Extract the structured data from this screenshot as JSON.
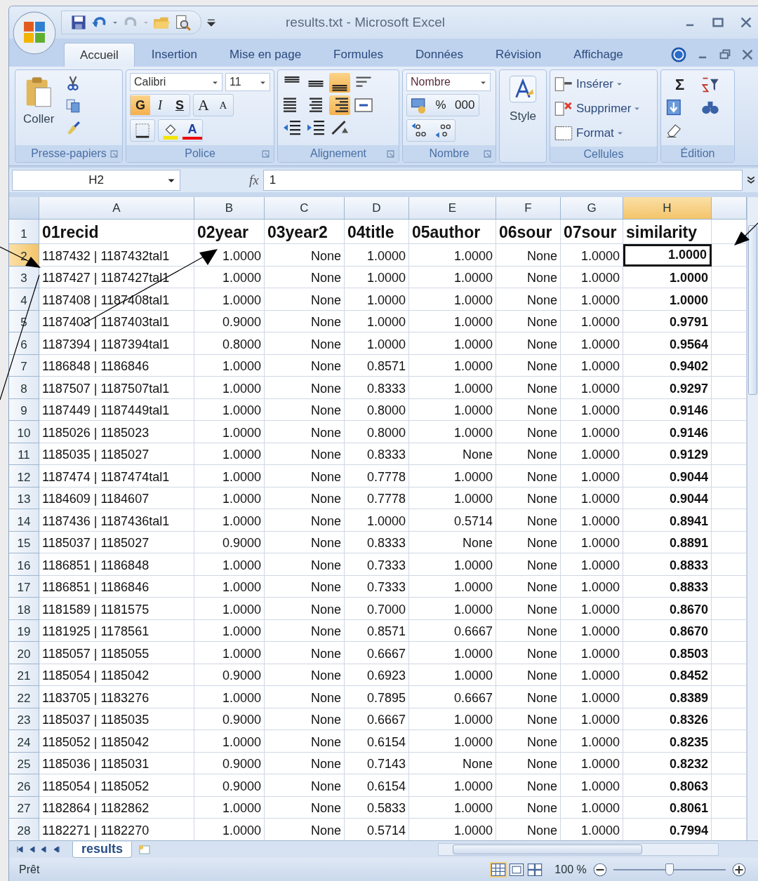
{
  "window": {
    "title": "results.txt - Microsoft Excel"
  },
  "tabs": [
    {
      "label": "Accueil",
      "selected": true
    },
    {
      "label": "Insertion",
      "selected": false
    },
    {
      "label": "Mise en page",
      "selected": false
    },
    {
      "label": "Formules",
      "selected": false
    },
    {
      "label": "Données",
      "selected": false
    },
    {
      "label": "Révision",
      "selected": false
    },
    {
      "label": "Affichage",
      "selected": false
    }
  ],
  "ribbon": {
    "clipboard": {
      "label": "Presse-papiers",
      "paste": "Coller"
    },
    "font": {
      "label": "Police",
      "family": "Calibri",
      "size": "11",
      "styles": [
        {
          "kind": "bold",
          "label": "G",
          "on": true
        },
        {
          "kind": "italic",
          "label": "I",
          "on": false
        },
        {
          "kind": "underline",
          "label": "S",
          "on": false
        }
      ],
      "grow": "A",
      "shrink": "A",
      "color_letter": "A"
    },
    "alignment": {
      "label": "Alignement",
      "vertical": [
        {
          "kind": "top",
          "on": false
        },
        {
          "kind": "middle",
          "on": false
        },
        {
          "kind": "bottom",
          "on": true
        }
      ],
      "horizontal": [
        {
          "kind": "left",
          "on": false
        },
        {
          "kind": "center",
          "on": false
        },
        {
          "kind": "right",
          "on": true
        }
      ]
    },
    "number": {
      "label": "Nombre",
      "format": "Nombre",
      "percent": "%",
      "thousands": "000"
    },
    "style": {
      "label": "Style"
    },
    "cells": {
      "label": "Cellules",
      "items": [
        {
          "kind": "insert",
          "label": "Insérer"
        },
        {
          "kind": "delete",
          "label": "Supprimer"
        },
        {
          "kind": "format",
          "label": "Format"
        }
      ]
    },
    "editing": {
      "label": "Édition",
      "sum": "Σ"
    }
  },
  "formula_bar": {
    "name_box": "H2",
    "fx": "fx",
    "value": "1"
  },
  "sheet": {
    "columns": [
      {
        "label": "A",
        "selected": false,
        "bold": false
      },
      {
        "label": "B",
        "selected": false,
        "bold": false
      },
      {
        "label": "C",
        "selected": false,
        "bold": false
      },
      {
        "label": "D",
        "selected": false,
        "bold": false
      },
      {
        "label": "E",
        "selected": false,
        "bold": false
      },
      {
        "label": "F",
        "selected": false,
        "bold": false
      },
      {
        "label": "G",
        "selected": false,
        "bold": false
      },
      {
        "label": "H",
        "selected": true,
        "bold": true
      }
    ],
    "rows": [
      {
        "label": "1",
        "kind": "header",
        "selected": false,
        "cells": [
          "01recid",
          "02year",
          "03year2",
          "04title",
          "05author",
          "06sour",
          "07sour",
          "similarity"
        ]
      },
      {
        "label": "2",
        "kind": "data",
        "selected": true,
        "cells": [
          "1187432 | 1187432tal1",
          "1.0000",
          "None",
          "1.0000",
          "1.0000",
          "None",
          "1.0000",
          "1.0000"
        ]
      },
      {
        "label": "3",
        "kind": "data",
        "selected": false,
        "cells": [
          "1187427 | 1187427tal1",
          "1.0000",
          "None",
          "1.0000",
          "1.0000",
          "None",
          "1.0000",
          "1.0000"
        ]
      },
      {
        "label": "4",
        "kind": "data",
        "selected": false,
        "cells": [
          "1187408 | 1187408tal1",
          "1.0000",
          "None",
          "1.0000",
          "1.0000",
          "None",
          "1.0000",
          "1.0000"
        ]
      },
      {
        "label": "5",
        "kind": "data",
        "selected": false,
        "cells": [
          "1187403 | 1187403tal1",
          "0.9000",
          "None",
          "1.0000",
          "1.0000",
          "None",
          "1.0000",
          "0.9791"
        ]
      },
      {
        "label": "6",
        "kind": "data",
        "selected": false,
        "cells": [
          "1187394 | 1187394tal1",
          "0.8000",
          "None",
          "1.0000",
          "1.0000",
          "None",
          "1.0000",
          "0.9564"
        ]
      },
      {
        "label": "7",
        "kind": "data",
        "selected": false,
        "cells": [
          "1186848 | 1186846",
          "1.0000",
          "None",
          "0.8571",
          "1.0000",
          "None",
          "1.0000",
          "0.9402"
        ]
      },
      {
        "label": "8",
        "kind": "data",
        "selected": false,
        "cells": [
          "1187507 | 1187507tal1",
          "1.0000",
          "None",
          "0.8333",
          "1.0000",
          "None",
          "1.0000",
          "0.9297"
        ]
      },
      {
        "label": "9",
        "kind": "data",
        "selected": false,
        "cells": [
          "1187449 | 1187449tal1",
          "1.0000",
          "None",
          "0.8000",
          "1.0000",
          "None",
          "1.0000",
          "0.9146"
        ]
      },
      {
        "label": "10",
        "kind": "data",
        "selected": false,
        "cells": [
          "1185026 | 1185023",
          "1.0000",
          "None",
          "0.8000",
          "1.0000",
          "None",
          "1.0000",
          "0.9146"
        ]
      },
      {
        "label": "11",
        "kind": "data",
        "selected": false,
        "cells": [
          "1185035 | 1185027",
          "1.0000",
          "None",
          "0.8333",
          "None",
          "None",
          "1.0000",
          "0.9129"
        ]
      },
      {
        "label": "12",
        "kind": "data",
        "selected": false,
        "cells": [
          "1187474 | 1187474tal1",
          "1.0000",
          "None",
          "0.7778",
          "1.0000",
          "None",
          "1.0000",
          "0.9044"
        ]
      },
      {
        "label": "13",
        "kind": "data",
        "selected": false,
        "cells": [
          "1184609 | 1184607",
          "1.0000",
          "None",
          "0.7778",
          "1.0000",
          "None",
          "1.0000",
          "0.9044"
        ]
      },
      {
        "label": "14",
        "kind": "data",
        "selected": false,
        "cells": [
          "1187436 | 1187436tal1",
          "1.0000",
          "None",
          "1.0000",
          "0.5714",
          "None",
          "1.0000",
          "0.8941"
        ]
      },
      {
        "label": "15",
        "kind": "data",
        "selected": false,
        "cells": [
          "1185037 | 1185027",
          "0.9000",
          "None",
          "0.8333",
          "None",
          "None",
          "1.0000",
          "0.8891"
        ]
      },
      {
        "label": "16",
        "kind": "data",
        "selected": false,
        "cells": [
          "1186851 | 1186848",
          "1.0000",
          "None",
          "0.7333",
          "1.0000",
          "None",
          "1.0000",
          "0.8833"
        ]
      },
      {
        "label": "17",
        "kind": "data",
        "selected": false,
        "cells": [
          "1186851 | 1186846",
          "1.0000",
          "None",
          "0.7333",
          "1.0000",
          "None",
          "1.0000",
          "0.8833"
        ]
      },
      {
        "label": "18",
        "kind": "data",
        "selected": false,
        "cells": [
          "1181589 | 1181575",
          "1.0000",
          "None",
          "0.7000",
          "1.0000",
          "None",
          "1.0000",
          "0.8670"
        ]
      },
      {
        "label": "19",
        "kind": "data",
        "selected": false,
        "cells": [
          "1181925 | 1178561",
          "1.0000",
          "None",
          "0.8571",
          "0.6667",
          "None",
          "1.0000",
          "0.8670"
        ]
      },
      {
        "label": "20",
        "kind": "data",
        "selected": false,
        "cells": [
          "1185057 | 1185055",
          "1.0000",
          "None",
          "0.6667",
          "1.0000",
          "None",
          "1.0000",
          "0.8503"
        ]
      },
      {
        "label": "21",
        "kind": "data",
        "selected": false,
        "cells": [
          "1185054 | 1185042",
          "0.9000",
          "None",
          "0.6923",
          "1.0000",
          "None",
          "1.0000",
          "0.8452"
        ]
      },
      {
        "label": "22",
        "kind": "data",
        "selected": false,
        "cells": [
          "1183705 | 1183276",
          "1.0000",
          "None",
          "0.7895",
          "0.6667",
          "None",
          "1.0000",
          "0.8389"
        ]
      },
      {
        "label": "23",
        "kind": "data",
        "selected": false,
        "cells": [
          "1185037 | 1185035",
          "0.9000",
          "None",
          "0.6667",
          "1.0000",
          "None",
          "1.0000",
          "0.8326"
        ]
      },
      {
        "label": "24",
        "kind": "data",
        "selected": false,
        "cells": [
          "1185052 | 1185042",
          "1.0000",
          "None",
          "0.6154",
          "1.0000",
          "None",
          "1.0000",
          "0.8235"
        ]
      },
      {
        "label": "25",
        "kind": "data",
        "selected": false,
        "cells": [
          "1185036 | 1185031",
          "0.9000",
          "None",
          "0.7143",
          "None",
          "None",
          "1.0000",
          "0.8232"
        ]
      },
      {
        "label": "26",
        "kind": "data",
        "selected": false,
        "cells": [
          "1185054 | 1185052",
          "0.9000",
          "None",
          "0.6154",
          "1.0000",
          "None",
          "1.0000",
          "0.8063"
        ]
      },
      {
        "label": "27",
        "kind": "data",
        "selected": false,
        "cells": [
          "1182864 | 1182862",
          "1.0000",
          "None",
          "0.5833",
          "1.0000",
          "None",
          "1.0000",
          "0.8061"
        ]
      },
      {
        "label": "28",
        "kind": "data",
        "selected": false,
        "cells": [
          "1182271 | 1182270",
          "1.0000",
          "None",
          "0.5714",
          "1.0000",
          "None",
          "1.0000",
          "0.7994"
        ]
      }
    ]
  },
  "sheet_tabs": [
    {
      "label": "results",
      "selected": true
    }
  ],
  "status_bar": {
    "text": "Prêt",
    "views": [
      {
        "kind": "normal",
        "selected": true
      },
      {
        "kind": "layout",
        "selected": false
      },
      {
        "kind": "break",
        "selected": false
      }
    ],
    "zoom": "100 %",
    "zoom_slider": {
      "level": 0.5
    }
  }
}
